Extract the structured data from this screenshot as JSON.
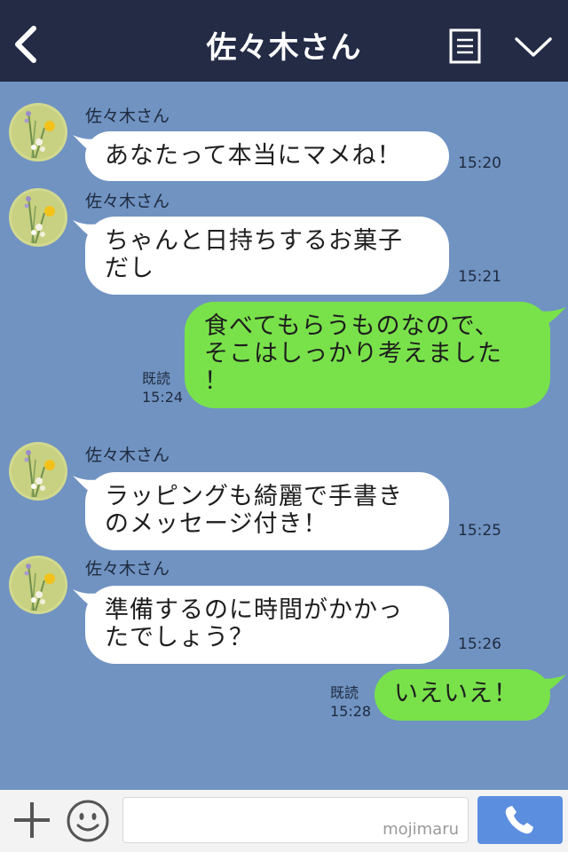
{
  "header": {
    "title": "佐々木さん",
    "icons": [
      "back-chevron-icon",
      "notes-menu-icon",
      "chevron-down-icon"
    ]
  },
  "messages": [
    {
      "dir": "in",
      "sender": "佐々木さん",
      "text": "あなたって本当にマメね！",
      "time": "15:20"
    },
    {
      "dir": "in",
      "sender": "佐々木さん",
      "lines": [
        "ちゃんと日持ちするお菓子",
        "だし"
      ],
      "time": "15:21"
    },
    {
      "dir": "out",
      "lines": [
        "食べてもらうものなので、",
        "そこはしっかり考えました",
        "！"
      ],
      "read": "既読",
      "time": "15:24"
    },
    {
      "dir": "in",
      "sender": "佐々木さん",
      "lines": [
        "ラッピングも綺麗で手書き",
        "のメッセージ付き！"
      ],
      "time": "15:25"
    },
    {
      "dir": "in",
      "sender": "佐々木さん",
      "lines": [
        "準備するのに時間がかかっ",
        "たでしょう？"
      ],
      "time": "15:26"
    },
    {
      "dir": "out",
      "text": "いえいえ！",
      "read": "既読",
      "time": "15:28"
    }
  ],
  "input": {
    "watermark": "mojimaru",
    "icons": [
      "plus-icon",
      "smile-icon",
      "phone-icon"
    ]
  },
  "colors": {
    "header_bg": "#232b45",
    "chat_bg": "#7093c2",
    "incoming_bubble": "#ffffff",
    "outgoing_bubble": "#79e24a",
    "send_button": "#5c8ee0"
  }
}
